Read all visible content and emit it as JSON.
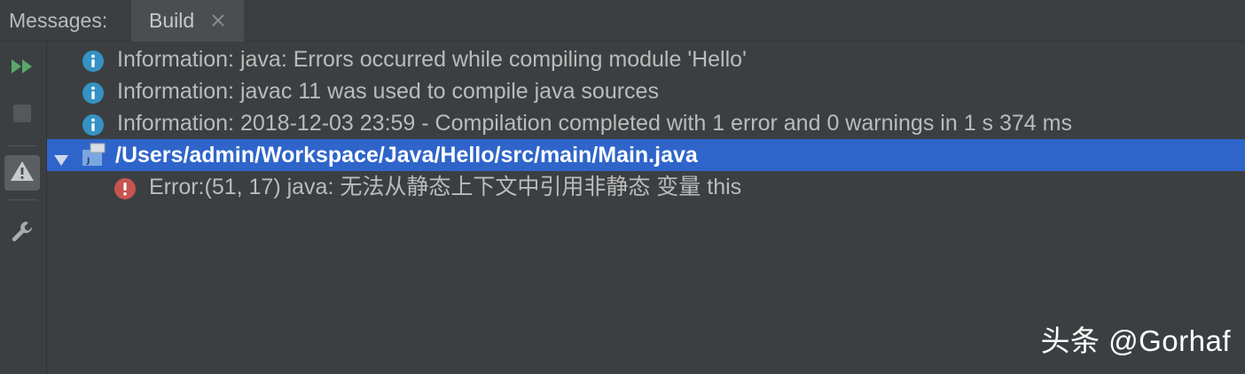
{
  "tabbar": {
    "messages_label": "Messages:",
    "active_tab": {
      "label": "Build",
      "close_icon": "close-icon"
    }
  },
  "toolbar": {
    "items": [
      {
        "name": "rerun",
        "icon": "double-play-icon",
        "color": "#59a869"
      },
      {
        "name": "stop",
        "icon": "stop-icon",
        "color": "#4d4d4d"
      },
      {
        "name": "warnings",
        "icon": "warning-icon",
        "active": true
      },
      {
        "name": "settings",
        "icon": "wrench-icon"
      }
    ]
  },
  "messages": [
    {
      "type": "info",
      "icon": "info-icon",
      "text": "Information: java: Errors occurred while compiling module 'Hello'"
    },
    {
      "type": "info",
      "icon": "info-icon",
      "text": "Information: javac 11 was used to compile java sources"
    },
    {
      "type": "info",
      "icon": "info-icon",
      "text": "Information: 2018-12-03 23:59 - Compilation completed with 1 error and 0 warnings in 1 s 374 ms"
    },
    {
      "type": "file",
      "icon": "java-file-icon",
      "expanded": true,
      "selected": true,
      "text": "/Users/admin/Workspace/Java/Hello/src/main/Main.java"
    },
    {
      "type": "error",
      "icon": "error-icon",
      "text": "Error:(51, 17)  java: 无法从静态上下文中引用非静态 变量 this"
    }
  ],
  "watermark": "头条 @Gorhaf",
  "colors": {
    "background": "#3c3f41",
    "selection": "#2f65ca",
    "info": "#3592c4",
    "error": "#c75450",
    "run": "#59a869"
  }
}
